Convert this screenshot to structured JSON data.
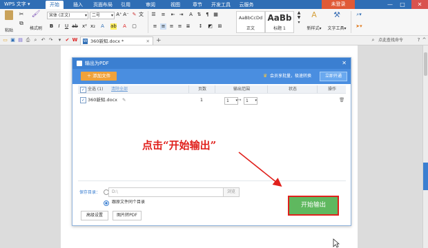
{
  "titlebar": {
    "app_name": "WPS 文字",
    "tabs": [
      "开始",
      "插入",
      "页面布局",
      "引用",
      "审阅",
      "视图",
      "章节",
      "开发工具",
      "云服务"
    ],
    "login": "未登录",
    "controls": {
      "minimize": "—",
      "maximize": "□",
      "close": "✕"
    }
  },
  "ribbon": {
    "paste": "粘贴",
    "format_painter": "格式刷",
    "font_name": "宋体 (正文)",
    "font_size": "二号",
    "styles": [
      {
        "preview": "AaBbCcDd",
        "label": "正文"
      },
      {
        "preview": "AaBb",
        "label": "标题 1"
      }
    ],
    "new_style": "新样式",
    "text_tools": "文字工具",
    "find_replace": "查找替换",
    "select": "选择"
  },
  "quickbar": {
    "doc_tab": "360新知.docx *",
    "add_tab": "+",
    "help_search": "点此查找命令"
  },
  "dialog": {
    "title": "输出为PDF",
    "close": "✕",
    "add_file": "添加文件",
    "vip_notice": "会员享批量，极速转换",
    "vip_button": "立即开通",
    "headers": {
      "select_all": "全选 (1)",
      "clear_all": "清除全部",
      "pages": "页数",
      "range": "输出范围",
      "status": "状态",
      "action": "操作"
    },
    "rows": [
      {
        "name": "360新知.docx",
        "pages": "1",
        "range_from": "1",
        "range_to": "1"
      }
    ],
    "save_dir_label": "保存目录：",
    "save_path_placeholder": "D:\\",
    "browse": "浏览",
    "same_dir_option": "跟原文件同个目录",
    "advanced": "高级设置",
    "image_pdf": "图片转PDF",
    "start": "开始输出"
  },
  "annotation": {
    "text": "点击“开始输出”",
    "color": "#e0201c"
  }
}
